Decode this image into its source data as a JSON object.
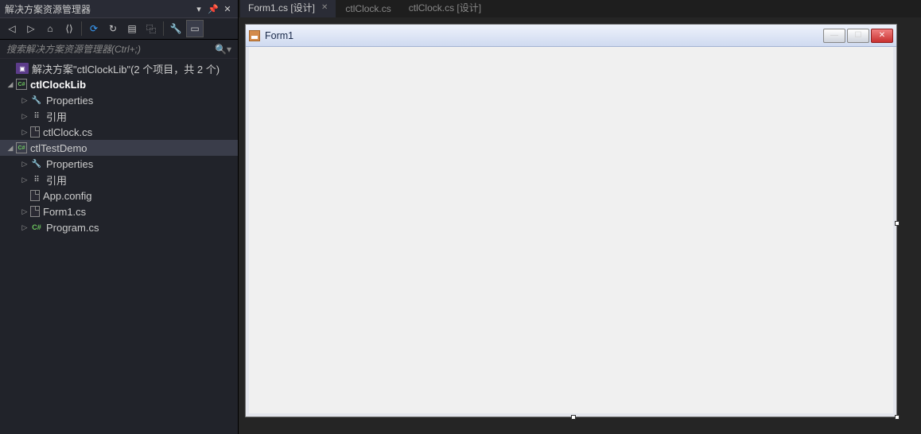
{
  "panel": {
    "title": "解决方案资源管理器",
    "searchPlaceholder": "搜索解决方案资源管理器(Ctrl+;)",
    "solution": "解决方案\"ctlClockLib\"(2 个项目，共 2 个)"
  },
  "tree": [
    {
      "d": 0,
      "icon": "sln",
      "label": "解决方案\"ctlClockLib\"(2 个项目，共 2 个)",
      "expand": "none"
    },
    {
      "d": 0,
      "icon": "proj",
      "label": "ctlClockLib",
      "expand": "open",
      "bold": true
    },
    {
      "d": 1,
      "icon": "wrench",
      "label": "Properties",
      "expand": "closed"
    },
    {
      "d": 1,
      "icon": "ref",
      "label": "引用",
      "expand": "closed"
    },
    {
      "d": 1,
      "icon": "file",
      "label": "ctlClock.cs",
      "expand": "closed"
    },
    {
      "d": 0,
      "icon": "proj",
      "label": "ctlTestDemo",
      "expand": "open",
      "sel": true
    },
    {
      "d": 1,
      "icon": "wrench",
      "label": "Properties",
      "expand": "closed"
    },
    {
      "d": 1,
      "icon": "ref",
      "label": "引用",
      "expand": "closed"
    },
    {
      "d": 1,
      "icon": "file",
      "label": "App.config",
      "expand": "none"
    },
    {
      "d": 1,
      "icon": "file",
      "label": "Form1.cs",
      "expand": "closed"
    },
    {
      "d": 1,
      "icon": "cs",
      "label": "Program.cs",
      "expand": "closed"
    }
  ],
  "tabs": [
    {
      "label": "Form1.cs [设计]",
      "active": true,
      "closable": true
    },
    {
      "label": "ctlClock.cs",
      "active": false
    },
    {
      "label": "ctlClock.cs [设计]",
      "active": false
    }
  ],
  "form": {
    "title": "Form1"
  }
}
